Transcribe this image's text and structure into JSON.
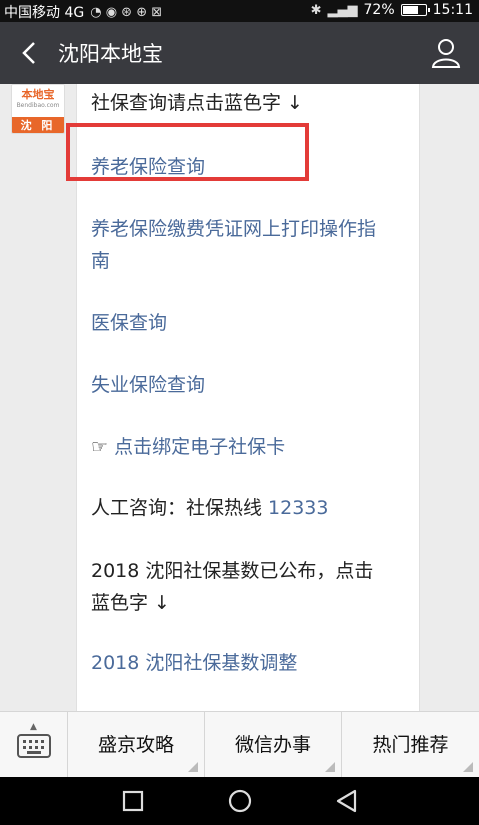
{
  "status_bar": {
    "carrier": "中国移动 4G",
    "battery_text": "72%",
    "time": "15:11",
    "battery_level": 0.72
  },
  "header": {
    "title": "沈阳本地宝"
  },
  "avatar": {
    "logo_name": "本地宝",
    "logo_url": "Bendibao.com",
    "city": "沈 阳"
  },
  "message": {
    "intro": "社保查询请点击蓝色字 ↓",
    "link_pension": "养老保险查询",
    "link_receipt_line1": "养老保险缴费凭证网上打印操作指",
    "link_receipt_line2": "南",
    "link_medical": "医保查询",
    "link_unemployment": "失业保险查询",
    "bind_prefix": "☞ ",
    "link_bind_card": "点击绑定电子社保卡",
    "hotline_label": "人工咨询：社保热线 ",
    "hotline_number": "12333",
    "base_notice_line1": "2018 沈阳社保基数已公布，点击",
    "base_notice_line2": "蓝色字 ↓",
    "link_base_adjust": "2018 沈阳社保基数调整"
  },
  "menu": {
    "items": [
      "盛京攻略",
      "微信办事",
      "热门推荐"
    ]
  },
  "colors": {
    "header_bg": "#393a3f",
    "link": "#4a6a9a",
    "highlight_border": "#e33b38",
    "brand_orange": "#e8672a"
  }
}
